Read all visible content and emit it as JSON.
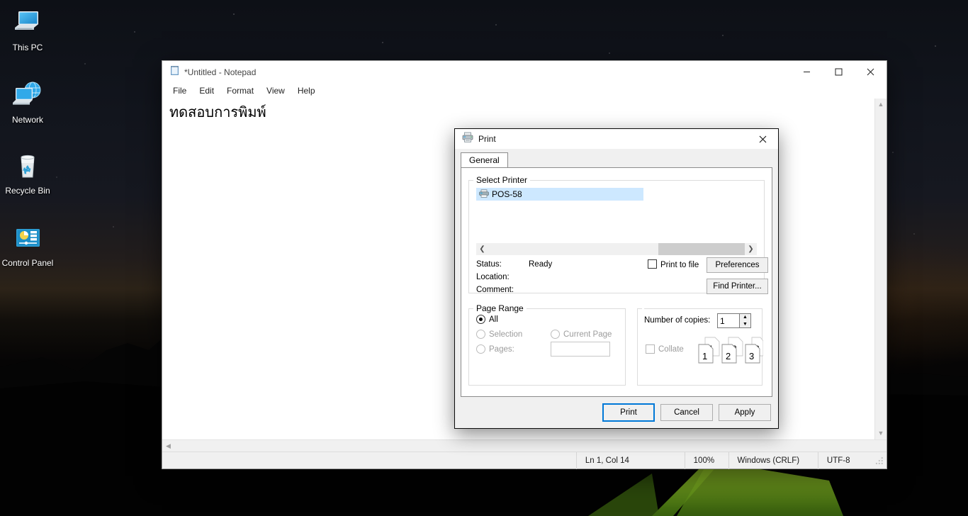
{
  "desktop": {
    "icons": [
      {
        "name": "this-pc",
        "label": "This PC",
        "icon": "monitor-icon"
      },
      {
        "name": "network",
        "label": "Network",
        "icon": "network-globe-icon"
      },
      {
        "name": "recycle-bin",
        "label": "Recycle Bin",
        "icon": "recycle-bin-icon"
      },
      {
        "name": "control-panel",
        "label": "Control Panel",
        "icon": "control-panel-icon"
      }
    ]
  },
  "notepad": {
    "title": "*Untitled - Notepad",
    "title_icon": "notepad-icon",
    "menus": [
      "File",
      "Edit",
      "Format",
      "View",
      "Help"
    ],
    "window_buttons": {
      "minimize": "minimize-icon",
      "maximize": "maximize-icon",
      "close": "close-icon"
    },
    "content": "ทดสอบการพิมพ์",
    "statusbar": {
      "position": "Ln 1, Col 14",
      "zoom": "100%",
      "line_endings": "Windows (CRLF)",
      "encoding": "UTF-8"
    }
  },
  "print_dialog": {
    "title": "Print",
    "title_icon": "printer-icon",
    "close_icon": "close-icon",
    "tabs": [
      {
        "label": "General",
        "active": true
      }
    ],
    "select_printer": {
      "legend": "Select Printer",
      "printers": [
        {
          "name": "POS-58",
          "icon": "printer-small-icon",
          "selected": true
        }
      ],
      "scroll_left_icon": "chevron-left-icon",
      "scroll_right_icon": "chevron-right-icon",
      "info": [
        {
          "label": "Status:",
          "value": "Ready"
        },
        {
          "label": "Location:",
          "value": ""
        },
        {
          "label": "Comment:",
          "value": ""
        }
      ],
      "print_to_file": {
        "label": "Print to file",
        "checked": false
      },
      "preferences_button": "Preferences",
      "find_printer_button": "Find Printer..."
    },
    "page_range": {
      "legend": "Page Range",
      "options": [
        {
          "label": "All",
          "selected": true,
          "disabled": false
        },
        {
          "label": "Selection",
          "selected": false,
          "disabled": true
        },
        {
          "label": "Current Page",
          "selected": false,
          "disabled": true
        },
        {
          "label": "Pages:",
          "selected": false,
          "disabled": true
        }
      ],
      "pages_value": "",
      "pages_placeholder": ""
    },
    "copies": {
      "label": "Number of copies:",
      "value": "1",
      "spin_up_icon": "spinner-up-icon",
      "spin_down_icon": "spinner-down-icon",
      "collate": {
        "label": "Collate",
        "checked": false,
        "disabled": true
      },
      "collate_pages": [
        "1",
        "1",
        "2",
        "2",
        "3",
        "3"
      ]
    },
    "buttons": {
      "print": "Print",
      "cancel": "Cancel",
      "apply": "Apply"
    }
  },
  "colors": {
    "accent": "#0078d7",
    "selection": "#cde8ff",
    "dialog_bg": "#f0f0f0",
    "close_hover": "#e81123"
  }
}
